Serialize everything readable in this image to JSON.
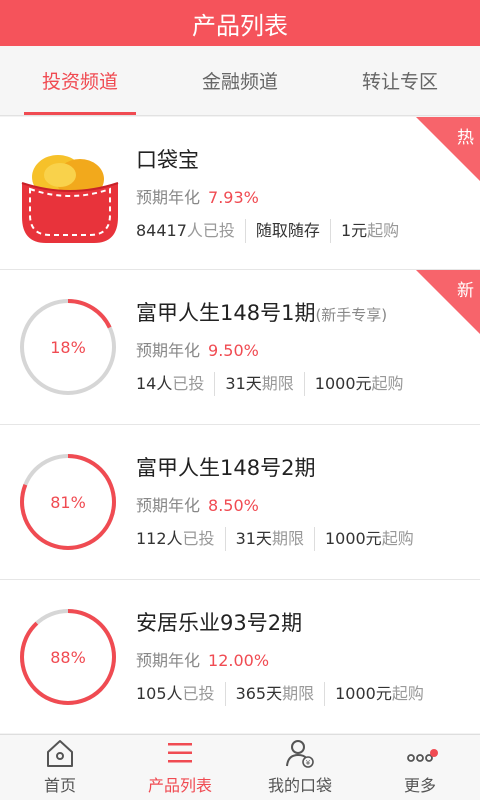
{
  "header": {
    "title": "产品列表"
  },
  "tabs": [
    {
      "label": "投资频道",
      "active": true
    },
    {
      "label": "金融频道",
      "active": false
    },
    {
      "label": "转让专区",
      "active": false
    }
  ],
  "products": [
    {
      "name": "口袋宝",
      "note": "",
      "rate_label": "预期年化",
      "rate": "7.93%",
      "investors": "84417",
      "investors_unit": "人已投",
      "term": "随取随存",
      "term_unit": "",
      "min": "1元",
      "min_unit": "起购",
      "tag": "热",
      "icon": "purse-icon"
    },
    {
      "name": "富甲人生148号1期",
      "note": "(新手专享)",
      "rate_label": "预期年化",
      "rate": "9.50%",
      "progress": "18%",
      "progress_value": 0.18,
      "investors": "14人",
      "investors_unit": "已投",
      "term": "31天",
      "term_unit": "期限",
      "min": "1000元",
      "min_unit": "起购",
      "tag": "新"
    },
    {
      "name": "富甲人生148号2期",
      "note": "",
      "rate_label": "预期年化",
      "rate": "8.50%",
      "progress": "81%",
      "progress_value": 0.81,
      "investors": "112人",
      "investors_unit": "已投",
      "term": "31天",
      "term_unit": "期限",
      "min": "1000元",
      "min_unit": "起购"
    },
    {
      "name": "安居乐业93号2期",
      "note": "",
      "rate_label": "预期年化",
      "rate": "12.00%",
      "progress": "88%",
      "progress_value": 0.88,
      "investors": "105人",
      "investors_unit": "已投",
      "term": "365天",
      "term_unit": "期限",
      "min": "1000元",
      "min_unit": "起购"
    }
  ],
  "tabbar": [
    {
      "label": "首页",
      "icon": "home-icon",
      "active": false
    },
    {
      "label": "产品列表",
      "icon": "list-icon",
      "active": true
    },
    {
      "label": "我的口袋",
      "icon": "user-wallet-icon",
      "active": false
    },
    {
      "label": "更多",
      "icon": "more-icon",
      "active": false,
      "badge": true
    }
  ],
  "colors": {
    "accent": "#f04b52",
    "header": "#f5535b",
    "ring_track": "#d6d6d6"
  }
}
